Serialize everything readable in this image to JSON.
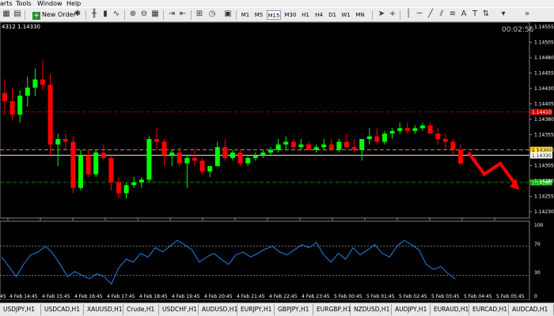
{
  "menu": {
    "items": [
      "arts",
      "Tools",
      "Window",
      "Help"
    ]
  },
  "toolbar": {
    "new_order_label": "New Order",
    "timeframes": [
      "M1",
      "M5",
      "M15",
      "M30",
      "H1",
      "H4",
      "D1",
      "W1",
      "MN"
    ],
    "active_timeframe": "M15"
  },
  "chart": {
    "header_text": "4312 1.14330",
    "countdown": "00:02:56",
    "colors": {
      "bull": "#00ff00",
      "bear": "#ff0000",
      "background": "#000000",
      "rsi_line": "#1e90ff",
      "arrow": "#ff0000"
    },
    "levels": [
      {
        "label": "1.14410",
        "price": 1.1441,
        "color": "#cc0000"
      },
      {
        "label": "1.14340",
        "price": 1.1434,
        "color": "#ffcc00"
      },
      {
        "label": "1.14330",
        "price": 1.1433,
        "color": "#ffffff"
      },
      {
        "label": "1.14280",
        "price": 1.1428,
        "color": "#00aa00"
      }
    ],
    "price_ticks": [
      "1.14555",
      "1.14505",
      "1.14480",
      "1.14455",
      "1.14430",
      "1.14405",
      "1.14380",
      "1.14355",
      "1.14330",
      "1.14305",
      "1.14280",
      "1.14255",
      "1.14230"
    ],
    "rsi_ticks": [
      "100",
      "70",
      "30",
      "0"
    ],
    "time_labels": [
      "4 Feb 14:45",
      "4 Feb 15:45",
      "4 Feb 16:45",
      "4 Feb 17:45",
      "4 Feb 18:45",
      "4 Feb 19:45",
      "4 Feb 20:45",
      "4 Feb 21:45",
      "4 Feb 22:45",
      "4 Feb 23:45",
      "5 Feb 00:45",
      "5 Feb 01:45",
      "5 Feb 02:45",
      "5 Feb 03:45",
      "5 Feb 04:45",
      "5 Feb 05:45"
    ],
    "time_label_prefix": "45"
  },
  "chart_data": {
    "type": "candlestick",
    "symbol_timeframe": "M15",
    "ylim": [
      1.1422,
      1.1457
    ],
    "candles": [
      [
        1.14445,
        1.1447,
        1.14405,
        1.1443
      ],
      [
        1.1443,
        1.14455,
        1.14395,
        1.14405
      ],
      [
        1.14405,
        1.1445,
        1.1439,
        1.1444
      ],
      [
        1.1444,
        1.14475,
        1.1442,
        1.14455
      ],
      [
        1.14455,
        1.1449,
        1.1444,
        1.1447
      ],
      [
        1.1447,
        1.14505,
        1.1445,
        1.1446
      ],
      [
        1.1446,
        1.1448,
        1.1433,
        1.1435
      ],
      [
        1.1435,
        1.1437,
        1.1431,
        1.1436
      ],
      [
        1.1436,
        1.1437,
        1.1434,
        1.14355
      ],
      [
        1.14355,
        1.14365,
        1.1426,
        1.1427
      ],
      [
        1.1427,
        1.1434,
        1.14265,
        1.1433
      ],
      [
        1.1433,
        1.1434,
        1.1429,
        1.14295
      ],
      [
        1.14295,
        1.1434,
        1.1429,
        1.14335
      ],
      [
        1.14335,
        1.1435,
        1.1432,
        1.14325
      ],
      [
        1.14325,
        1.1433,
        1.14265,
        1.1428
      ],
      [
        1.1428,
        1.1429,
        1.1425,
        1.1426
      ],
      [
        1.1426,
        1.1428,
        1.1425,
        1.14275
      ],
      [
        1.14275,
        1.1429,
        1.1427,
        1.1428
      ],
      [
        1.1428,
        1.1429,
        1.1427,
        1.14285
      ],
      [
        1.14285,
        1.14365,
        1.1428,
        1.1436
      ],
      [
        1.1436,
        1.1438,
        1.1434,
        1.14355
      ],
      [
        1.14355,
        1.1436,
        1.1431,
        1.1433
      ],
      [
        1.1433,
        1.1434,
        1.1431,
        1.14335
      ],
      [
        1.14335,
        1.14345,
        1.1431,
        1.14315
      ],
      [
        1.14315,
        1.1433,
        1.1427,
        1.14325
      ],
      [
        1.14325,
        1.1434,
        1.1431,
        1.1432
      ],
      [
        1.1432,
        1.14325,
        1.14295,
        1.143
      ],
      [
        1.143,
        1.1431,
        1.1429,
        1.1431
      ],
      [
        1.1431,
        1.14355,
        1.1431,
        1.14345
      ],
      [
        1.14345,
        1.1436,
        1.1432,
        1.14325
      ],
      [
        1.14325,
        1.1434,
        1.1432,
        1.14335
      ],
      [
        1.14335,
        1.1434,
        1.1431,
        1.14315
      ],
      [
        1.14315,
        1.1433,
        1.1431,
        1.14325
      ],
      [
        1.14325,
        1.14335,
        1.1432,
        1.1433
      ],
      [
        1.1433,
        1.1434,
        1.14325,
        1.14335
      ],
      [
        1.14335,
        1.14345,
        1.1433,
        1.1434
      ],
      [
        1.1434,
        1.1436,
        1.14335,
        1.1435
      ],
      [
        1.1435,
        1.14365,
        1.1434,
        1.14355
      ],
      [
        1.14355,
        1.1436,
        1.1434,
        1.14345
      ],
      [
        1.14345,
        1.1436,
        1.1434,
        1.1435
      ],
      [
        1.1435,
        1.14355,
        1.1434,
        1.1434
      ],
      [
        1.1434,
        1.1435,
        1.14335,
        1.14345
      ],
      [
        1.14345,
        1.1436,
        1.1434,
        1.1435
      ],
      [
        1.1435,
        1.1436,
        1.1434,
        1.1434
      ],
      [
        1.1434,
        1.1436,
        1.14335,
        1.14355
      ],
      [
        1.14355,
        1.1437,
        1.1435,
        1.14345
      ],
      [
        1.14345,
        1.1436,
        1.14335,
        1.1434
      ],
      [
        1.1434,
        1.1436,
        1.1432,
        1.1436
      ],
      [
        1.1436,
        1.1438,
        1.1435,
        1.14365
      ],
      [
        1.14365,
        1.1438,
        1.1435,
        1.14355
      ],
      [
        1.14355,
        1.14375,
        1.1435,
        1.1437
      ],
      [
        1.1437,
        1.1438,
        1.1436,
        1.14375
      ],
      [
        1.14375,
        1.1439,
        1.1437,
        1.1438
      ],
      [
        1.1438,
        1.1439,
        1.1437,
        1.14375
      ],
      [
        1.14375,
        1.14385,
        1.1437,
        1.1438
      ],
      [
        1.1438,
        1.1439,
        1.14375,
        1.14385
      ],
      [
        1.14385,
        1.1439,
        1.1437,
        1.1437
      ],
      [
        1.1437,
        1.1438,
        1.1435,
        1.1436
      ],
      [
        1.1436,
        1.1437,
        1.1434,
        1.14355
      ],
      [
        1.14355,
        1.1436,
        1.1433,
        1.1434
      ],
      [
        1.1434,
        1.1435,
        1.1431,
        1.14315
      ]
    ],
    "projection": [
      [
        1.14335,
        0
      ],
      [
        1.14295,
        1
      ],
      [
        1.14315,
        2
      ],
      [
        1.14275,
        3
      ]
    ],
    "rsi": {
      "ylim": [
        0,
        100
      ],
      "levels": [
        70,
        30
      ],
      "values": [
        55,
        42,
        28,
        45,
        58,
        62,
        70,
        60,
        45,
        28,
        35,
        30,
        25,
        32,
        28,
        18,
        40,
        52,
        48,
        60,
        55,
        68,
        62,
        70,
        78,
        72,
        65,
        48,
        55,
        60,
        52,
        45,
        58,
        62,
        55,
        60,
        66,
        70,
        62,
        58,
        65,
        72,
        68,
        75,
        58,
        48,
        60,
        52,
        68,
        58,
        65,
        72,
        60,
        55,
        70,
        78,
        72,
        65,
        45,
        38,
        42,
        32,
        25
      ]
    }
  },
  "tabs": [
    "USDJPY,H1",
    "USDCAD,H1",
    "XAUUSD,H1",
    "Crude,H1",
    "USDCHF,H1",
    "AUDUSD,H1",
    "EURJPY,H1",
    "GBPJPY,H1",
    "EURGBP,H1",
    "NZDUSD,H1",
    "AUDJPY,H1",
    "EURAUD,H1",
    "EURCAD,H1",
    "AUDCAD,H1"
  ]
}
